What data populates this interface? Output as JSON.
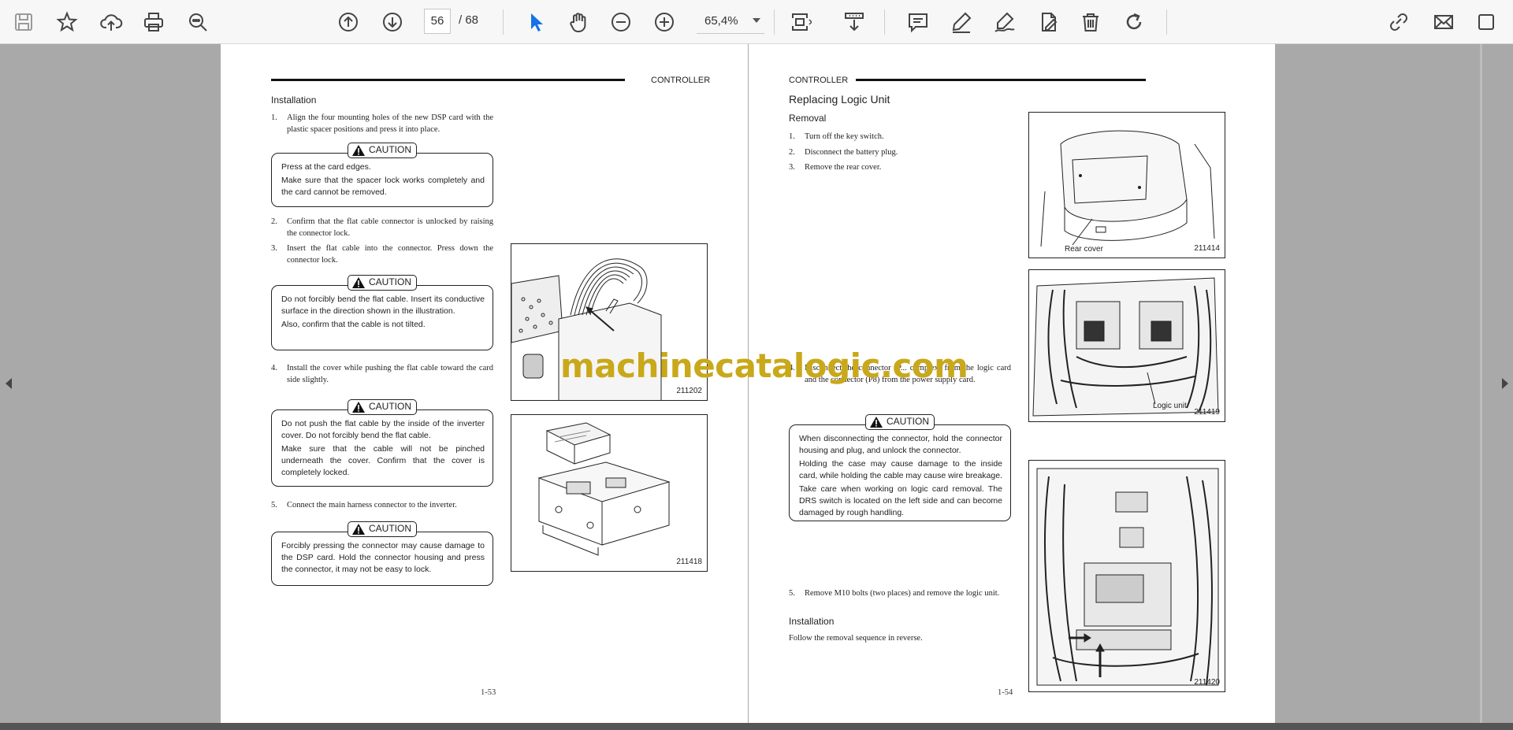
{
  "toolbar": {
    "current_page": "56",
    "page_separator": "/",
    "total_pages": "68",
    "zoom": "65,4%",
    "icons": [
      "save-icon",
      "bookmark-star-icon",
      "upload-cloud-icon",
      "print-icon",
      "zoom-search-icon",
      "page-up-icon",
      "page-down-icon",
      "select-pointer-icon",
      "hand-pan-icon",
      "zoom-out-icon",
      "zoom-in-icon",
      "page-fit-icon",
      "scroll-mode-icon",
      "comment-icon",
      "highlight-pen-icon",
      "sign-icon",
      "edit-pdf-icon",
      "delete-icon",
      "rotate-icon",
      "share-link-icon",
      "mail-icon",
      "more-icon"
    ]
  },
  "left_page": {
    "header": "CONTROLLER",
    "section_title": "Installation",
    "steps": [
      {
        "num": "1.",
        "text": "Align the four mounting holes of the new DSP card with the plastic spacer positions and press it into place."
      },
      {
        "num": "2.",
        "text": "Confirm that the flat cable connector is unlocked by raising the connector lock."
      },
      {
        "num": "3.",
        "text": "Insert the flat cable into the connector.  Press down the connector lock."
      },
      {
        "num": "4.",
        "text": "Install the cover while pushing the flat cable toward the card side slightly."
      },
      {
        "num": "5.",
        "text": "Connect the main harness connector to the inverter."
      }
    ],
    "cautions": [
      {
        "label": "CAUTION",
        "lines": [
          "Press at the card edges.",
          "Make sure that the spacer lock works completely and the card cannot be removed."
        ]
      },
      {
        "label": "CAUTION",
        "lines": [
          "Do not forcibly bend the flat cable.  Insert its conductive surface in the direction shown in the illustration.",
          "Also, confirm that the cable is not tilted."
        ]
      },
      {
        "label": "CAUTION",
        "lines": [
          "Do not push the flat cable by the inside of the inverter cover. Do not forcibly bend the flat cable.",
          "Make sure that the cable will not be pinched underneath the cover.  Confirm that the cover is completely locked."
        ]
      },
      {
        "label": "CAUTION",
        "lines": [
          "Forcibly pressing the connector may cause damage to the DSP card. Hold the connector housing and press the connector, it may not be easy to lock."
        ]
      }
    ],
    "figures": [
      {
        "number": "211202"
      },
      {
        "number": "211418"
      }
    ],
    "page_number": "1-53"
  },
  "right_page": {
    "header": "CONTROLLER",
    "title": "Replacing Logic Unit",
    "removal_title": "Removal",
    "steps": [
      {
        "num": "1.",
        "text": "Turn off the key switch."
      },
      {
        "num": "2.",
        "text": "Disconnect the battery plug."
      },
      {
        "num": "3.",
        "text": "Remove the rear cover."
      },
      {
        "num": "4.",
        "text": "Disconnect the connector (P... complex) from the logic card and the connector (P8) from the power supply card."
      },
      {
        "num": "5.",
        "text": "Remove M10 bolts (two places) and remove the logic unit."
      }
    ],
    "caution": {
      "label": "CAUTION",
      "lines": [
        "When disconnecting the connector, hold the connector housing and plug, and unlock the connector.",
        "Holding the case may cause damage to the inside card, while holding the cable may cause wire breakage.",
        "Take care when working on logic card removal. The DRS switch is located on the left side and can become damaged by rough handling."
      ]
    },
    "installation_title": "Installation",
    "installation_text": "Follow the removal sequence in reverse.",
    "figures": [
      {
        "number": "211414",
        "label": "Rear cover"
      },
      {
        "number": "211419",
        "label": "Logic unit"
      },
      {
        "number": "211420"
      }
    ],
    "page_number": "1-54"
  },
  "watermark": "machinecatalogic.com"
}
